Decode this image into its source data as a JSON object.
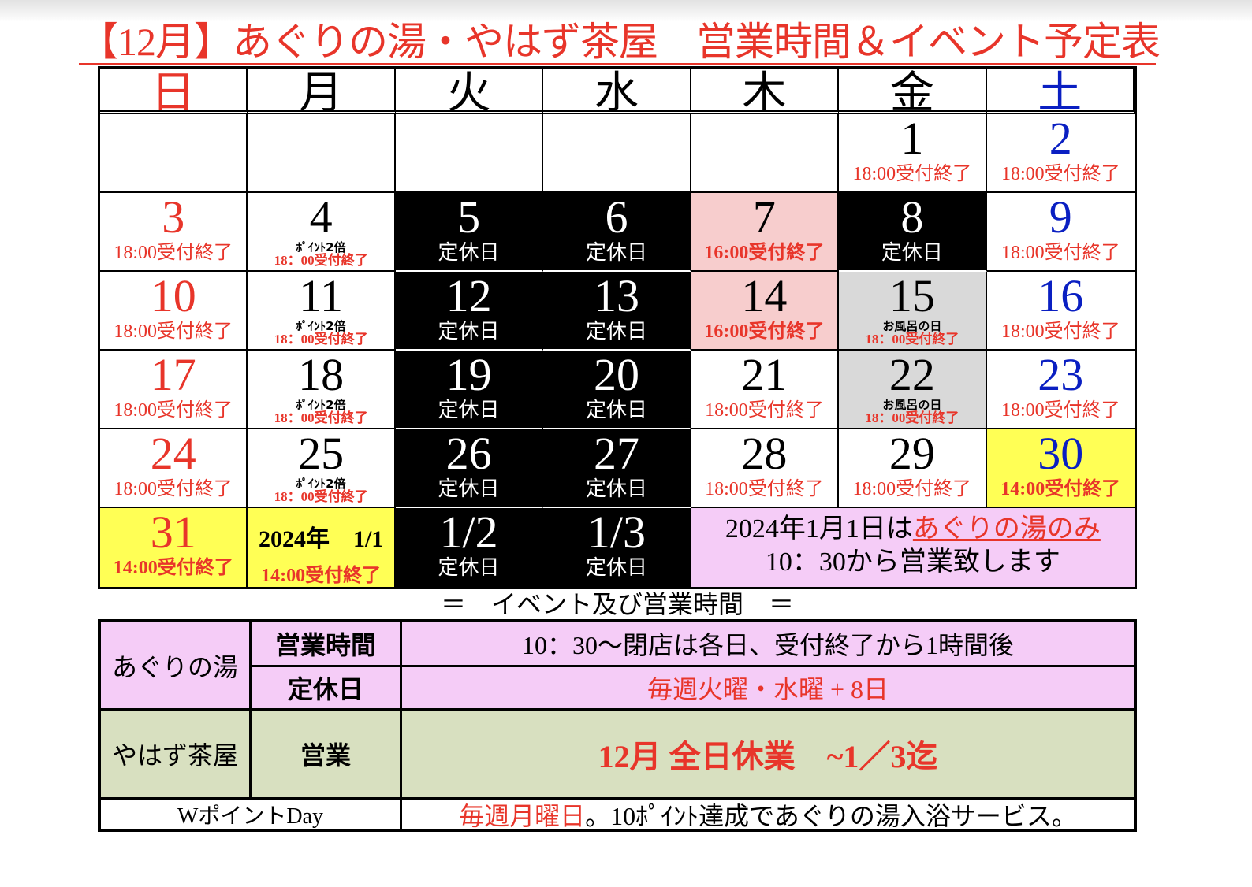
{
  "title": "【12月】あぐりの湯・やはず茶屋　営業時間＆イベント予定表",
  "colors": {
    "red": "#e8352a",
    "blue": "#0a1fc2",
    "closed": "#000000",
    "pink": "#f7cdcd",
    "gray": "#d9d9d9",
    "yellow": "#ffff55",
    "lavender": "#f5ccf7",
    "olive": "#d8e0c0"
  },
  "weekdays": [
    "日",
    "月",
    "火",
    "水",
    "木",
    "金",
    "土"
  ],
  "weeks": [
    [
      {
        "num": "",
        "style": "blank"
      },
      {
        "num": "",
        "style": "blank"
      },
      {
        "num": "",
        "style": "blank"
      },
      {
        "num": "",
        "style": "blank"
      },
      {
        "num": "",
        "style": "blank"
      },
      {
        "num": "1",
        "note": "18:00受付終了",
        "style": "normal"
      },
      {
        "num": "2",
        "note": "18:00受付終了",
        "style": "normal",
        "numcolor": "blue"
      }
    ],
    [
      {
        "num": "3",
        "note": "18:00受付終了",
        "style": "normal",
        "numcolor": "red"
      },
      {
        "num": "4",
        "sub": "ﾎﾟｲﾝﾄ2倍",
        "subnote": "18：00受付終了",
        "style": "normal"
      },
      {
        "num": "5",
        "note": "定休日",
        "style": "closed"
      },
      {
        "num": "6",
        "note": "定休日",
        "style": "closed"
      },
      {
        "num": "7",
        "note": "16:00受付終了",
        "style": "pink",
        "bold": true
      },
      {
        "num": "8",
        "note": "定休日",
        "style": "closed"
      },
      {
        "num": "9",
        "note": "18:00受付終了",
        "style": "normal",
        "numcolor": "blue"
      }
    ],
    [
      {
        "num": "10",
        "note": "18:00受付終了",
        "style": "normal",
        "numcolor": "red"
      },
      {
        "num": "11",
        "sub": "ﾎﾟｲﾝﾄ2倍",
        "subnote": "18：00受付終了",
        "style": "normal"
      },
      {
        "num": "12",
        "note": "定休日",
        "style": "closed"
      },
      {
        "num": "13",
        "note": "定休日",
        "style": "closed"
      },
      {
        "num": "14",
        "note": "16:00受付終了",
        "style": "pink",
        "bold": true
      },
      {
        "num": "15",
        "sub": "お風呂の日",
        "subnote": "18：00受付終了",
        "style": "gray"
      },
      {
        "num": "16",
        "note": "18:00受付終了",
        "style": "normal",
        "numcolor": "blue"
      }
    ],
    [
      {
        "num": "17",
        "note": "18:00受付終了",
        "style": "normal",
        "numcolor": "red"
      },
      {
        "num": "18",
        "sub": "ﾎﾟｲﾝﾄ2倍",
        "subnote": "18：00受付終了",
        "style": "normal"
      },
      {
        "num": "19",
        "note": "定休日",
        "style": "closed"
      },
      {
        "num": "20",
        "note": "定休日",
        "style": "closed"
      },
      {
        "num": "21",
        "note": "18:00受付終了",
        "style": "normal"
      },
      {
        "num": "22",
        "sub": "お風呂の日",
        "subnote": "18：00受付終了",
        "style": "gray"
      },
      {
        "num": "23",
        "note": "18:00受付終了",
        "style": "normal",
        "numcolor": "blue"
      }
    ],
    [
      {
        "num": "24",
        "note": "18:00受付終了",
        "style": "normal",
        "numcolor": "red"
      },
      {
        "num": "25",
        "sub": "ﾎﾟｲﾝﾄ2倍",
        "subnote": "18：00受付終了",
        "style": "normal"
      },
      {
        "num": "26",
        "note": "定休日",
        "style": "closed"
      },
      {
        "num": "27",
        "note": "定休日",
        "style": "closed"
      },
      {
        "num": "28",
        "note": "18:00受付終了",
        "style": "normal"
      },
      {
        "num": "29",
        "note": "18:00受付終了",
        "style": "normal"
      },
      {
        "num": "30",
        "note": "14:00受付終了",
        "style": "yellow",
        "numcolor": "blue",
        "bold": true
      }
    ]
  ],
  "last_week": {
    "d31": {
      "num": "31",
      "note": "14:00受付終了"
    },
    "jan1": {
      "label": "2024年　1/1",
      "note": "14:00受付終了"
    },
    "jan2": {
      "num": "1/2",
      "note": "定休日"
    },
    "jan3": {
      "num": "1/3",
      "note": "定休日"
    },
    "message_pre": "2024年1月1日は",
    "message_highlight": "あぐりの湯のみ",
    "message_line2": "10：30から営業致します"
  },
  "subtitle": "＝　イベント及び営業時間　＝",
  "info": {
    "agri_label": "あぐりの湯",
    "hours_label": "営業時間",
    "hours_value": "10：30～閉店は各日、受付終了から1時間後",
    "closed_label": "定休日",
    "closed_value": "毎週火曜・水曜 + 8日",
    "yahazu_label": "やはず茶屋",
    "business_label": "営業",
    "business_value": "12月 全日休業　~1／3迄",
    "wpoint_label": "WポイントDay",
    "wpoint_value_red": "毎週月曜日",
    "wpoint_value_rest": "。10ﾎﾟｲﾝﾄ達成であぐりの湯入浴サービス。"
  }
}
